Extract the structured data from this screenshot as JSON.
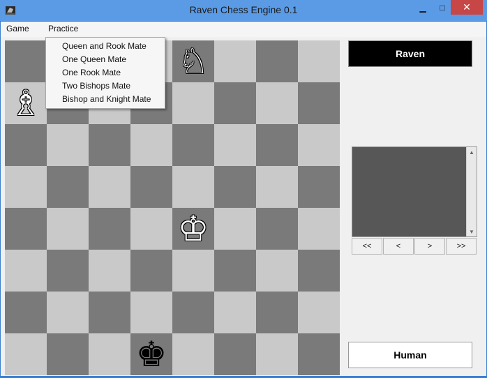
{
  "window": {
    "title": "Raven Chess Engine 0.1",
    "minimize_glyph": "▁",
    "maximize_glyph": "□",
    "close_glyph": "✕"
  },
  "menu": {
    "items": [
      "Game",
      "Practice"
    ],
    "practice_open": true,
    "practice_items": [
      "Queen and Rook Mate",
      "One Queen Mate",
      "One Rook Mate",
      "Two Bishops Mate",
      "Bishop and Knight Mate"
    ]
  },
  "board": {
    "light_color": "#c9c9c9",
    "dark_color": "#7a7a7a",
    "pieces": [
      {
        "square": "e8",
        "glyph": "♘",
        "color": "white",
        "name": "white-knight"
      },
      {
        "square": "a7",
        "glyph": "♗",
        "color": "white",
        "name": "white-bishop"
      },
      {
        "square": "e4",
        "glyph": "♔",
        "color": "white",
        "name": "white-king"
      },
      {
        "square": "d1",
        "glyph": "♚",
        "color": "black",
        "name": "black-king"
      }
    ]
  },
  "players": {
    "top": "Raven",
    "bottom": "Human"
  },
  "navigation": {
    "buttons": [
      "<<",
      "<",
      ">",
      ">>"
    ]
  },
  "scrollbar": {
    "up_glyph": "▲",
    "down_glyph": "▼"
  }
}
